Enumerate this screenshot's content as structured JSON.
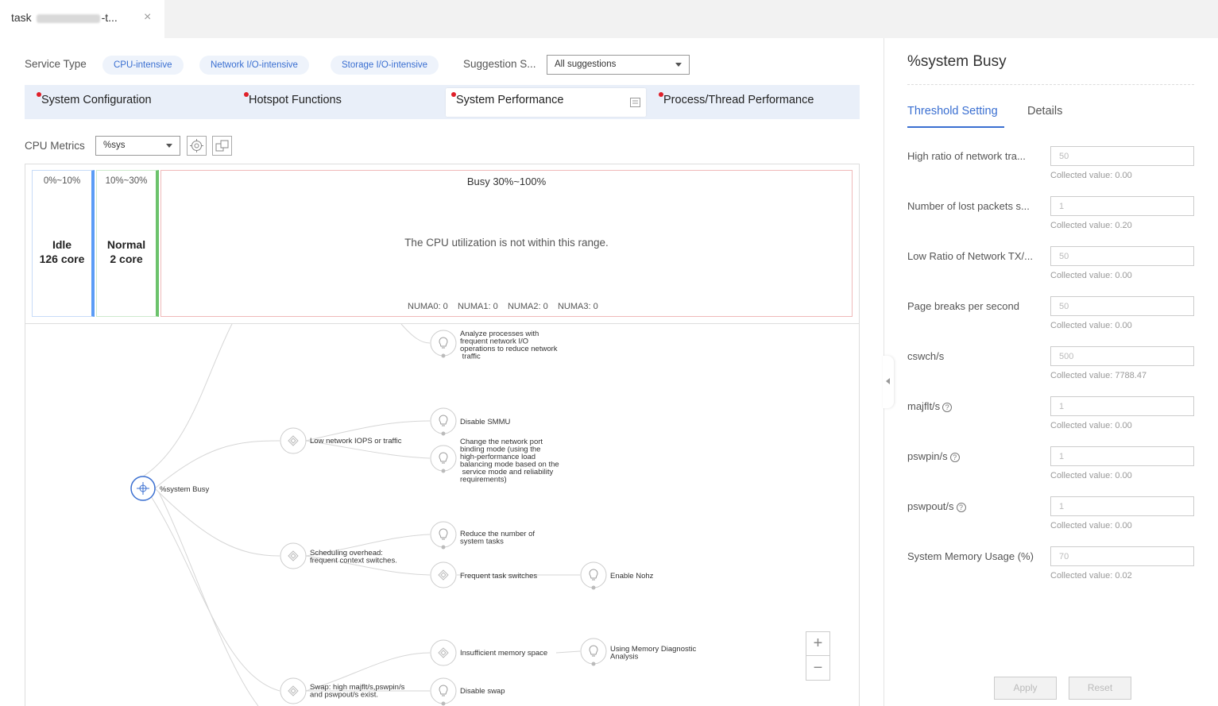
{
  "tab": {
    "title_prefix": "task",
    "title_suffix": "-t...",
    "close": "×"
  },
  "service": {
    "label": "Service Type",
    "types": [
      "CPU-intensive",
      "Network I/O-intensive",
      "Storage I/O-intensive"
    ],
    "suggestion_label": "Suggestion S...",
    "suggestion_value": "All suggestions"
  },
  "sections": [
    "System Configuration",
    "Hotspot Functions",
    "System Performance",
    "Process/Thread Performance"
  ],
  "cpu": {
    "label": "CPU Metrics",
    "metric": "%sys",
    "idle_range": "0%~10%",
    "idle_label": "Idle",
    "idle_count": "126 core",
    "normal_range": "10%~30%",
    "normal_label": "Normal",
    "normal_count": "2 core",
    "busy_range": "Busy 30%~100%",
    "busy_msg": "The CPU utilization is not within this range.",
    "numa": [
      "NUMA0: 0",
      "NUMA1: 0",
      "NUMA2: 0",
      "NUMA3: 0"
    ]
  },
  "colors": {
    "accent": "#3a6fd1",
    "idle_bar": "#5b9cf6",
    "normal_bar": "#6cc36c",
    "busy_border": "#f0b9b9",
    "alert_dot": "#e0202a"
  },
  "mindmap": {
    "root": "%system Busy",
    "nodes": {
      "n1": [
        "Analyze processes with",
        "frequent network I/O",
        "operations to reduce network",
        " traffic"
      ],
      "n2": [
        "Low network IOPS or traffic"
      ],
      "n3": [
        "Disable SMMU"
      ],
      "n4": [
        "Change the network port",
        "binding mode (using the",
        "high-performance load",
        "balancing mode based on the",
        " service mode and reliability",
        "requirements)"
      ],
      "n5": [
        "Scheduling overhead:",
        "frequent context switches."
      ],
      "n6": [
        "Reduce the number of",
        "system tasks"
      ],
      "n7": [
        "Frequent task switches"
      ],
      "n8": [
        "Enable Nohz"
      ],
      "n9": [
        "Insufficient memory space"
      ],
      "n10": [
        "Using Memory Diagnostic",
        "Analysis"
      ],
      "n11": [
        "Swap: high majflt/s,pswpin/s",
        "and pswpout/s exist."
      ],
      "n12": [
        "Disable swap"
      ]
    },
    "zoom_in": "+",
    "zoom_out": "−"
  },
  "panel": {
    "title": "%system Busy",
    "tabs": [
      "Threshold Setting",
      "Details"
    ],
    "fields": [
      {
        "label": "High ratio of network tra...",
        "value": "50",
        "collected": "Collected value: 0.00"
      },
      {
        "label": "Number of lost packets s...",
        "value": "1",
        "collected": "Collected value: 0.20"
      },
      {
        "label": "Low Ratio of Network TX/...",
        "value": "50",
        "collected": "Collected value: 0.00"
      },
      {
        "label": "Page breaks per second",
        "value": "50",
        "collected": "Collected value: 0.00"
      },
      {
        "label": "cswch/s",
        "value": "500",
        "collected": "Collected value: 7788.47"
      },
      {
        "label": "majflt/s",
        "value": "1",
        "collected": "Collected value: 0.00"
      },
      {
        "label": "pswpin/s",
        "value": "1",
        "collected": "Collected value: 0.00"
      },
      {
        "label": "pswpout/s",
        "value": "1",
        "collected": "Collected value: 0.00"
      },
      {
        "label": "System Memory Usage (%)",
        "value": "70",
        "collected": "Collected value: 0.02"
      }
    ],
    "apply": "Apply",
    "reset": "Reset"
  }
}
